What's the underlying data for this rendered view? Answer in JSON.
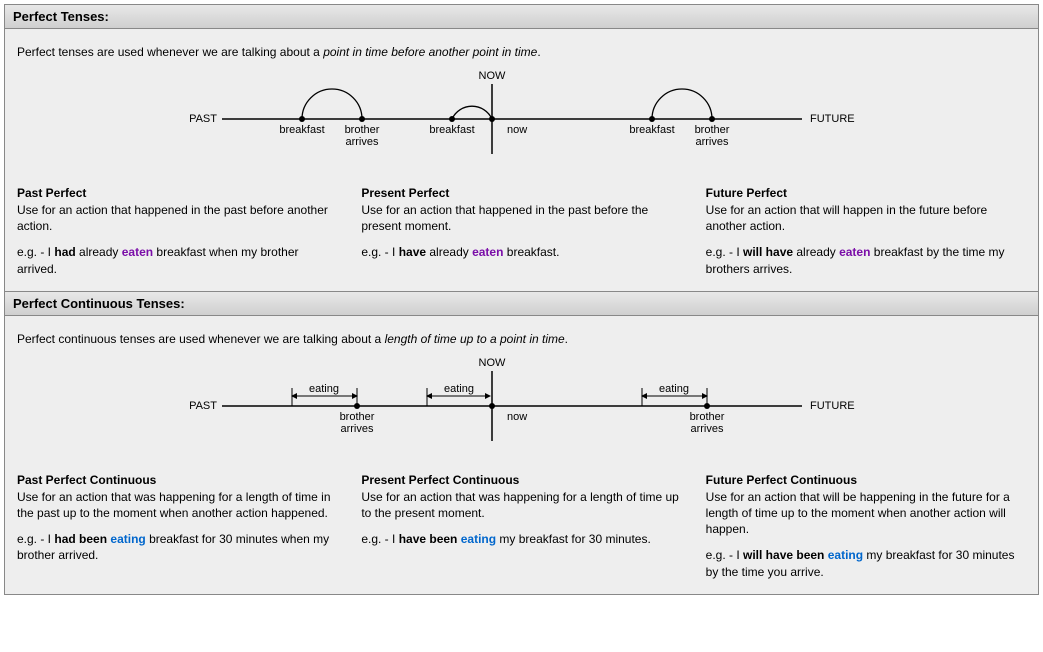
{
  "section1": {
    "header": "Perfect Tenses:",
    "intro_prefix": "Perfect tenses are used whenever we are talking about a ",
    "intro_em": "point in time before another point in time",
    "intro_suffix": ".",
    "diagram": {
      "now": "NOW",
      "past": "PAST",
      "future": "FUTURE",
      "g1_a": "breakfast",
      "g1_b": "brother",
      "g1_c": "arrives",
      "g2_a": "breakfast",
      "g2_b": "now",
      "g3_a": "breakfast",
      "g3_b": "brother",
      "g3_c": "arrives"
    },
    "col1": {
      "title": "Past Perfect",
      "desc": "Use for an action that happened in the past before another action.",
      "ex_pre": "e.g. - I ",
      "ex_b1": "had",
      "ex_mid1": " already ",
      "ex_colored": "eaten",
      "ex_post": " breakfast when my brother arrived."
    },
    "col2": {
      "title": "Present Perfect",
      "desc": "Use for an action that happened in the past before the present moment.",
      "ex_pre": "e.g. - I ",
      "ex_b1": "have",
      "ex_mid1": " already ",
      "ex_colored": "eaten",
      "ex_post": " breakfast."
    },
    "col3": {
      "title": "Future Perfect",
      "desc": "Use for an action that will happen in the future before another action.",
      "ex_pre": "e.g. - I ",
      "ex_b1": "will have",
      "ex_mid1": " already ",
      "ex_colored": "eaten",
      "ex_post": " breakfast by the time my brothers arrives."
    }
  },
  "section2": {
    "header": "Perfect Continuous Tenses:",
    "intro_prefix": "Perfect continuous tenses are used whenever we are talking about a ",
    "intro_em": "length of time up to a point in time",
    "intro_suffix": ".",
    "diagram": {
      "now": "NOW",
      "past": "PAST",
      "future": "FUTURE",
      "eating": "eating",
      "g1_b": "brother",
      "g1_c": "arrives",
      "g2_b": "now",
      "g3_b": "brother",
      "g3_c": "arrives"
    },
    "col1": {
      "title": "Past Perfect Continuous",
      "desc": "Use for an action that was happening for a length of time in the past up to the moment when another action happened.",
      "ex_pre": "e.g. - I ",
      "ex_b1": "had been",
      "ex_mid1": " ",
      "ex_colored": "eating",
      "ex_post": " breakfast for 30 minutes when my brother arrived."
    },
    "col2": {
      "title": "Present Perfect Continuous",
      "desc": "Use for an action that was happening for a length of time up to the present moment.",
      "ex_pre": "e.g. - I ",
      "ex_b1": "have been",
      "ex_mid1": " ",
      "ex_colored": "eating",
      "ex_post": " my breakfast for 30 minutes."
    },
    "col3": {
      "title": "Future Perfect Continuous",
      "desc": "Use for an action that will be happening in the future for a length of time up to the moment when another action will happen.",
      "ex_pre": "e.g. - I ",
      "ex_b1": "will have been",
      "ex_mid1": " ",
      "ex_colored": "eating",
      "ex_post": " my breakfast for 30 minutes by the time you arrive."
    }
  }
}
